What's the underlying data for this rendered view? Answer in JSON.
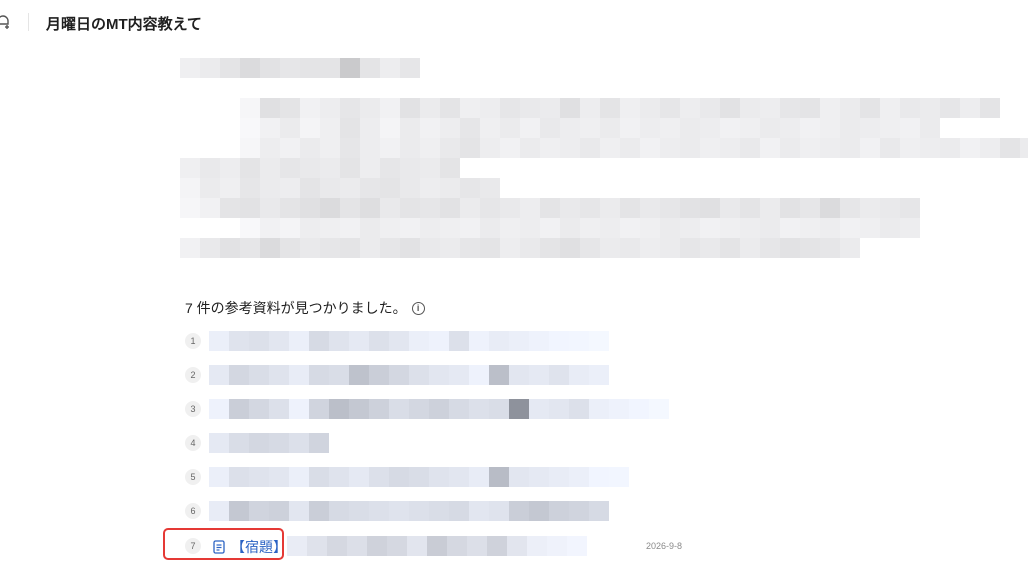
{
  "header": {
    "title": "月曜日のMT内容教えて"
  },
  "references": {
    "heading": "7 件の参考資料が見つかりました。",
    "info_icon_text": "i",
    "items": [
      {
        "number": "1"
      },
      {
        "number": "2"
      },
      {
        "number": "3"
      },
      {
        "number": "4"
      },
      {
        "number": "5"
      },
      {
        "number": "6"
      },
      {
        "number": "7",
        "link_text": "【宿題】",
        "date": "2026-9-8"
      }
    ]
  },
  "colors": {
    "link": "#2b63c4",
    "highlight": "#e53935"
  },
  "icons": {
    "header": "new-chat-icon",
    "reference": "document-icon",
    "info": "info-icon"
  }
}
